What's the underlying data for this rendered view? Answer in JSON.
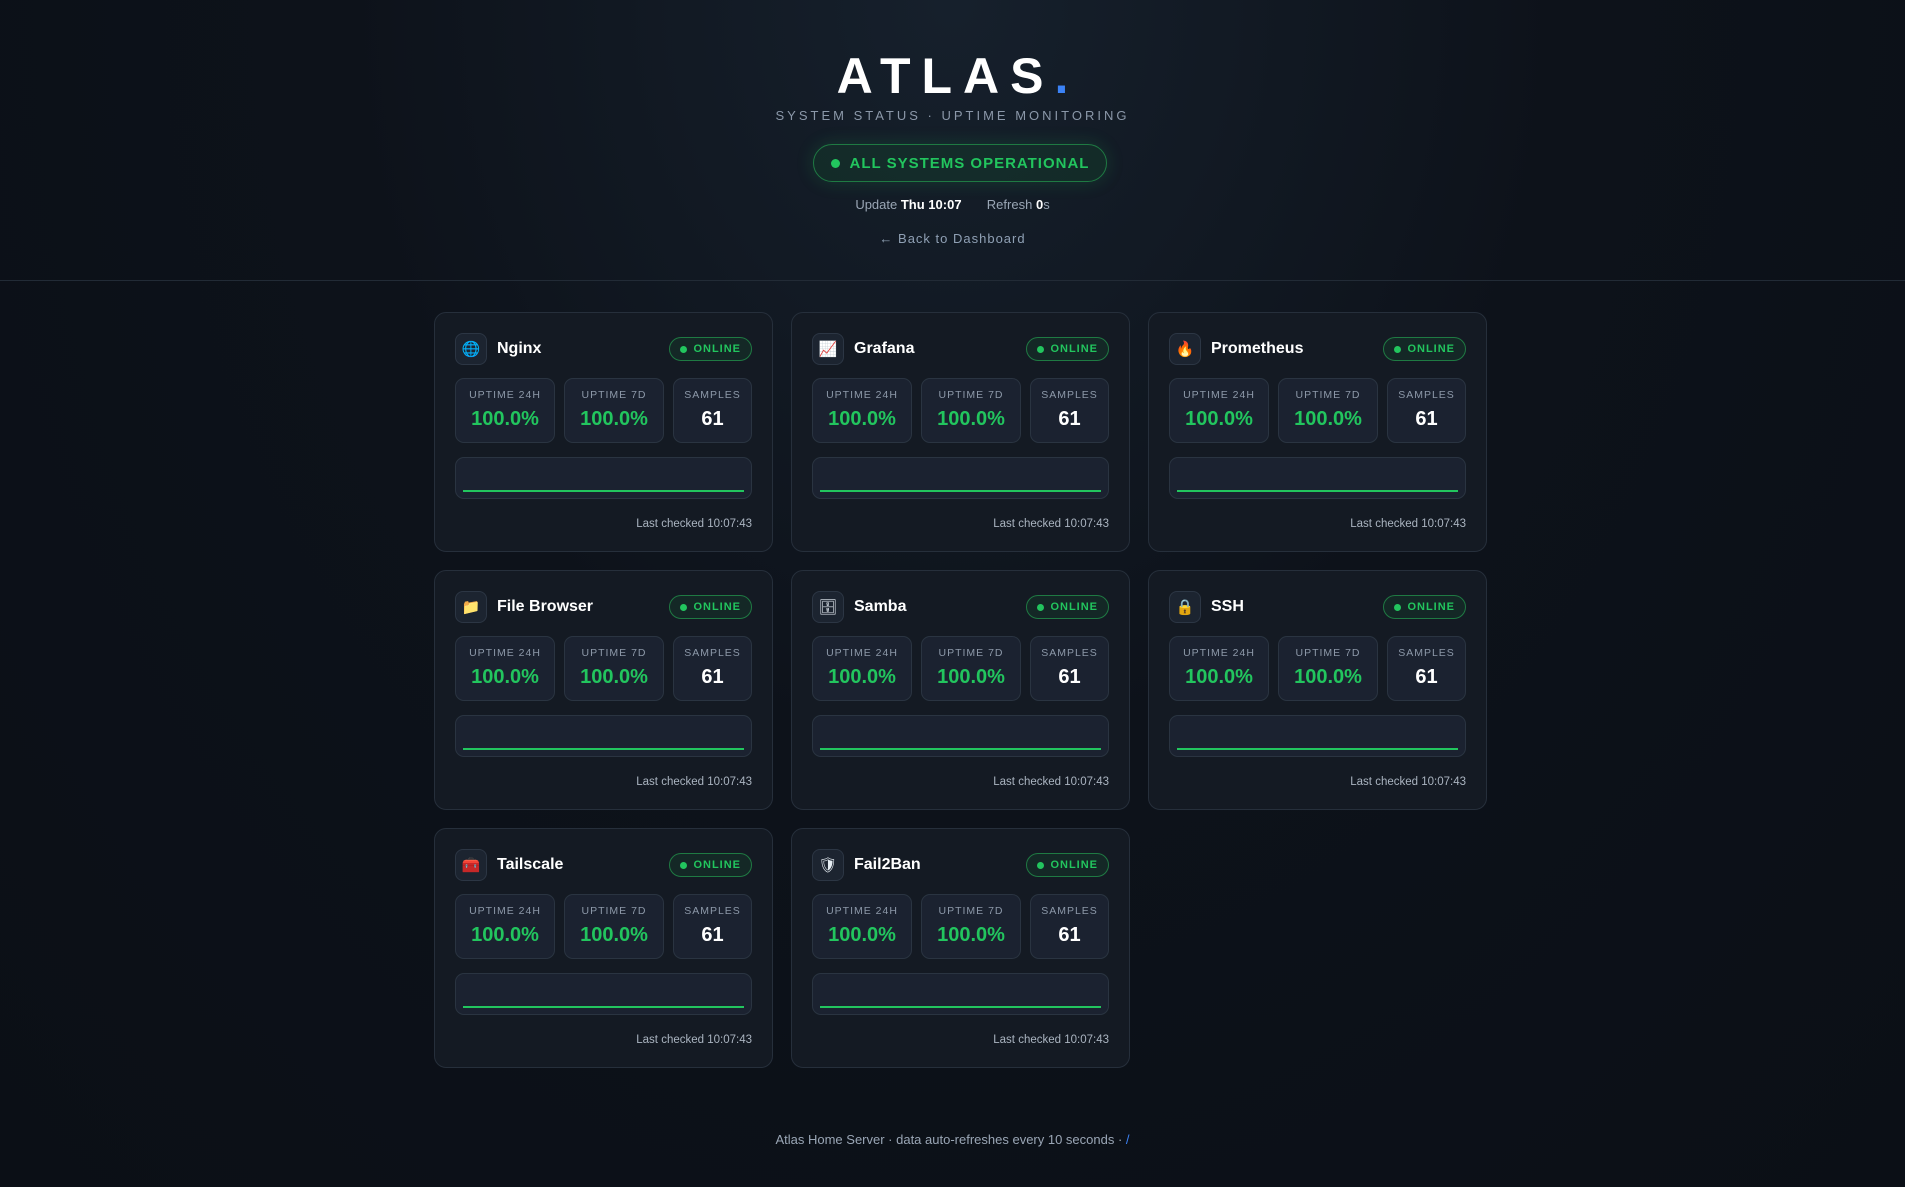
{
  "header": {
    "brand": "ATLAS",
    "brand_dot": ".",
    "subtitle": "SYSTEM STATUS · UPTIME MONITORING",
    "status": "ALL SYSTEMS OPERATIONAL",
    "update_label": "Update",
    "update_value": "Thu 10:07",
    "refresh_label": "Refresh",
    "refresh_value": "0",
    "refresh_unit": "s",
    "back_link": "← Back to Dashboard"
  },
  "labels": {
    "uptime_24h": "UPTIME 24H",
    "uptime_7d": "UPTIME 7D",
    "samples": "SAMPLES"
  },
  "services": [
    {
      "name": "Nginx",
      "icon": "globe-icon",
      "glyph": "🌐",
      "status": "ONLINE",
      "uptime_24h": "100.0%",
      "uptime_7d": "100.0%",
      "samples": "61",
      "last_checked": "Last checked 10:07:43",
      "availability": 1.0
    },
    {
      "name": "Grafana",
      "icon": "chart-icon",
      "glyph": "📈",
      "status": "ONLINE",
      "uptime_24h": "100.0%",
      "uptime_7d": "100.0%",
      "samples": "61",
      "last_checked": "Last checked 10:07:43",
      "availability": 1.0
    },
    {
      "name": "Prometheus",
      "icon": "fire-icon",
      "glyph": "🔥",
      "status": "ONLINE",
      "uptime_24h": "100.0%",
      "uptime_7d": "100.0%",
      "samples": "61",
      "last_checked": "Last checked 10:07:43",
      "availability": 1.0
    },
    {
      "name": "File Browser",
      "icon": "folder-icon",
      "glyph": "📁",
      "status": "ONLINE",
      "uptime_24h": "100.0%",
      "uptime_7d": "100.0%",
      "samples": "61",
      "last_checked": "Last checked 10:07:43",
      "availability": 1.0
    },
    {
      "name": "Samba",
      "icon": "cabinet-icon",
      "glyph": "🗄",
      "status": "ONLINE",
      "uptime_24h": "100.0%",
      "uptime_7d": "100.0%",
      "samples": "61",
      "last_checked": "Last checked 10:07:43",
      "availability": 1.0
    },
    {
      "name": "SSH",
      "icon": "lock-icon",
      "glyph": "🔒",
      "status": "ONLINE",
      "uptime_24h": "100.0%",
      "uptime_7d": "100.0%",
      "samples": "61",
      "last_checked": "Last checked 10:07:43",
      "availability": 1.0
    },
    {
      "name": "Tailscale",
      "icon": "toolbox-icon",
      "glyph": "🧰",
      "status": "ONLINE",
      "uptime_24h": "100.0%",
      "uptime_7d": "100.0%",
      "samples": "61",
      "last_checked": "Last checked 10:07:43",
      "availability": 1.0
    },
    {
      "name": "Fail2Ban",
      "icon": "shield-icon",
      "glyph": "🛡",
      "status": "ONLINE",
      "uptime_24h": "100.0%",
      "uptime_7d": "100.0%",
      "samples": "61",
      "last_checked": "Last checked 10:07:43",
      "availability": 1.0
    }
  ],
  "footer": {
    "text": "Atlas Home Server · data auto-refreshes every 10 seconds · ",
    "link": "/"
  },
  "colors": {
    "accent": "#3b82f6",
    "online": "#22c55e",
    "background": "#0d121a",
    "card": "#141a23"
  }
}
